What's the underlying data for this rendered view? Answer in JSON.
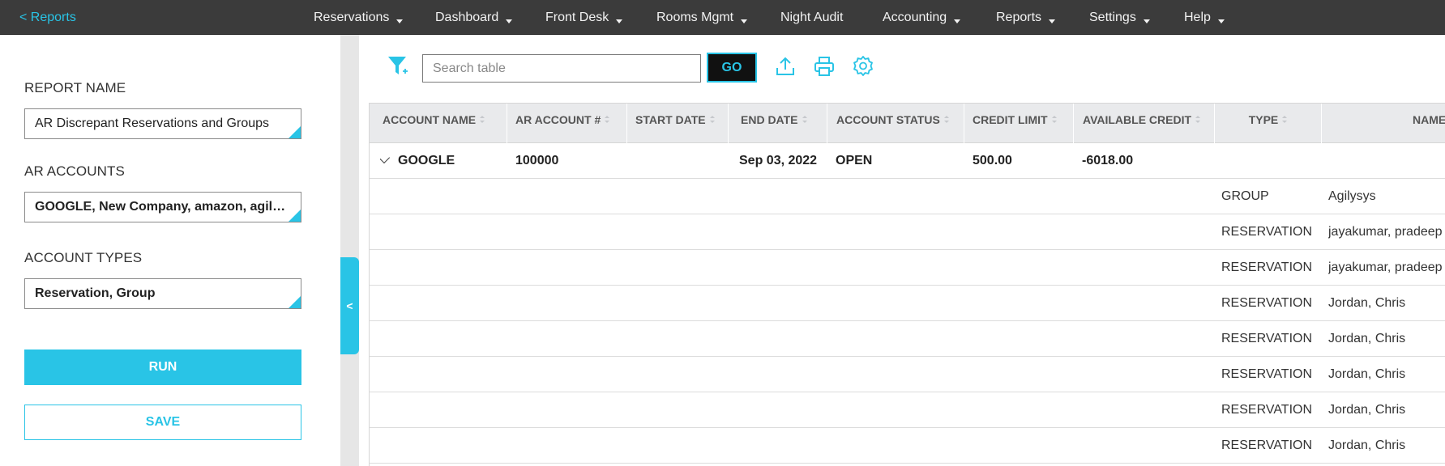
{
  "nav": {
    "back_label": "< Reports",
    "items": [
      {
        "label": "Reservations",
        "has_caret": true
      },
      {
        "label": "Dashboard",
        "has_caret": true
      },
      {
        "label": "Front Desk",
        "has_caret": true
      },
      {
        "label": "Rooms Mgmt",
        "has_caret": true
      },
      {
        "label": "Night Audit",
        "has_caret": false
      },
      {
        "label": "Accounting",
        "has_caret": true
      },
      {
        "label": "Reports",
        "has_caret": true
      },
      {
        "label": "Settings",
        "has_caret": true
      },
      {
        "label": "Help",
        "has_caret": true
      }
    ]
  },
  "left_panel": {
    "report_name_label": "REPORT NAME",
    "report_name_value": "AR Discrepant Reservations and Groups",
    "ar_accounts_label": "AR ACCOUNTS",
    "ar_accounts_value": "GOOGLE, New Company, amazon, agilysys, Test",
    "account_types_label": "ACCOUNT TYPES",
    "account_types_value": "Reservation, Group",
    "run_label": "RUN",
    "save_label": "SAVE",
    "collapse_label": "<"
  },
  "toolbar": {
    "search_placeholder": "Search table",
    "go_label": "GO",
    "icons": [
      "filter-add-icon",
      "export-icon",
      "print-icon",
      "gear-icon"
    ]
  },
  "table": {
    "columns": [
      "ACCOUNT NAME",
      "AR ACCOUNT #",
      "START DATE",
      "END DATE",
      "ACCOUNT STATUS",
      "CREDIT LIMIT",
      "AVAILABLE CREDIT",
      "TYPE",
      "NAME"
    ],
    "group_row": {
      "account_name": "GOOGLE",
      "ar_account": "100000",
      "start_date": "",
      "end_date": "Sep 03, 2022",
      "status": "OPEN",
      "credit_limit": "500.00",
      "available_credit": "-6018.00"
    },
    "rows": [
      {
        "type": "GROUP",
        "name": "Agilysys"
      },
      {
        "type": "RESERVATION",
        "name": "jayakumar, pradeep"
      },
      {
        "type": "RESERVATION",
        "name": "jayakumar, pradeep"
      },
      {
        "type": "RESERVATION",
        "name": "Jordan, Chris"
      },
      {
        "type": "RESERVATION",
        "name": "Jordan, Chris"
      },
      {
        "type": "RESERVATION",
        "name": "Jordan, Chris"
      },
      {
        "type": "RESERVATION",
        "name": "Jordan, Chris"
      },
      {
        "type": "RESERVATION",
        "name": "Jordan, Chris"
      }
    ]
  },
  "colors": {
    "accent": "#29c4e6",
    "nav_bg": "#3b3b3b",
    "header_bg": "#e9eaec"
  }
}
